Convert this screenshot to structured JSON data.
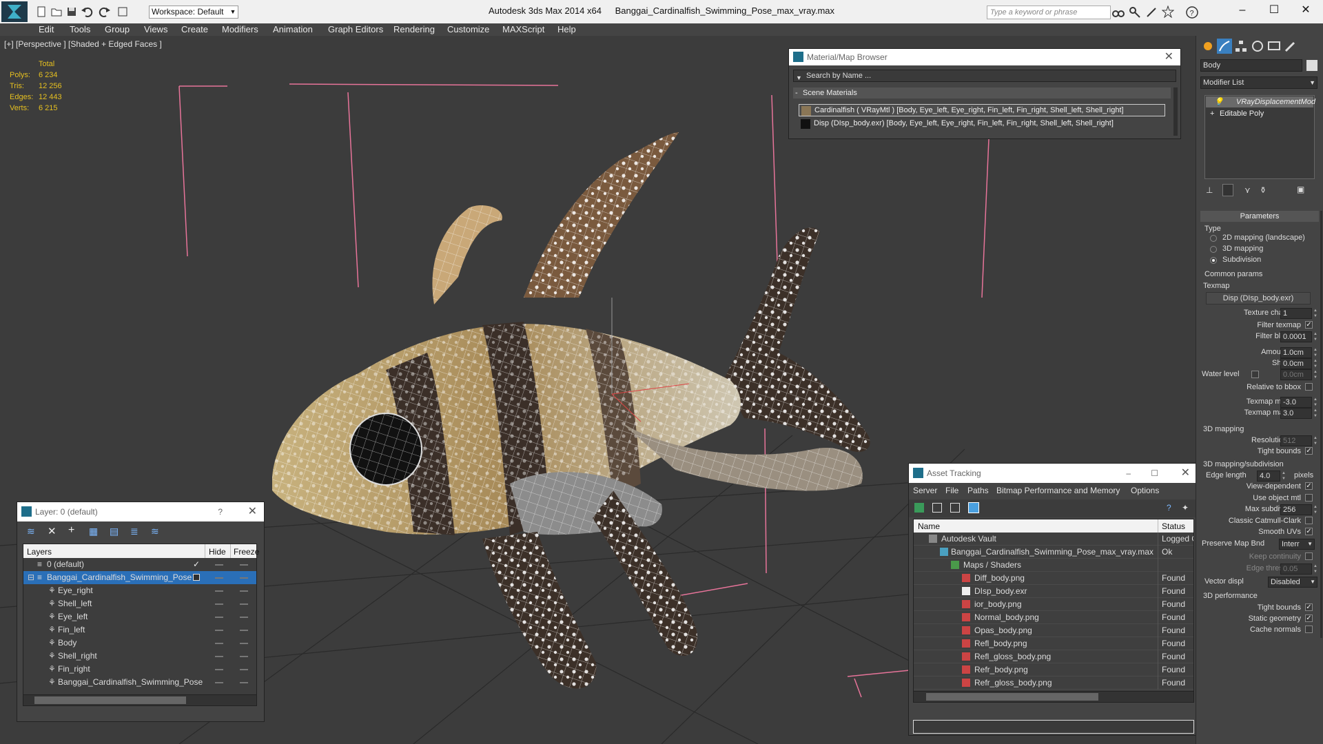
{
  "titlebar": {
    "workspace": "Workspace: Default",
    "app_title": "Autodesk 3ds Max  2014 x64",
    "file_title": "Banggai_Cardinalfish_Swimming_Pose_max_vray.max",
    "search_placeholder": "Type a keyword or phrase"
  },
  "menu": [
    "Edit",
    "Tools",
    "Group",
    "Views",
    "Create",
    "Modifiers",
    "Animation",
    "Graph Editors",
    "Rendering",
    "Customize",
    "MAXScript",
    "Help"
  ],
  "viewport": {
    "label": "[+] [Perspective ] [Shaded + Edged Faces ]",
    "stats": {
      "header": "Total",
      "rows": [
        {
          "label": "Polys:",
          "value": "6 234"
        },
        {
          "label": "Tris:",
          "value": "12 256"
        },
        {
          "label": "Edges:",
          "value": "12 443"
        },
        {
          "label": "Verts:",
          "value": "6 215"
        }
      ]
    }
  },
  "material_browser": {
    "title": "Material/Map Browser",
    "search_placeholder": "Search by Name ...",
    "section": "Scene Materials",
    "rows": [
      "Cardinalfish  ( VRayMtl )  [Body, Eye_left, Eye_right, Fin_left, Fin_right, Shell_left, Shell_right]",
      "Disp (DIsp_body.exr) [Body, Eye_left, Eye_right, Fin_left, Fin_right, Shell_left, Shell_right]"
    ]
  },
  "asset_tracking": {
    "title": "Asset Tracking",
    "menu": [
      "Server",
      "File",
      "Paths",
      "Bitmap Performance and Memory",
      "Options"
    ],
    "columns": [
      "Name",
      "Status"
    ],
    "rows": [
      {
        "name": "Autodesk Vault",
        "status": "Logged O"
      },
      {
        "name": "Banggai_Cardinalfish_Swimming_Pose_max_vray.max",
        "status": "Ok"
      },
      {
        "name": "Maps / Shaders",
        "status": ""
      },
      {
        "name": "Diff_body.png",
        "status": "Found"
      },
      {
        "name": "DIsp_body.exr",
        "status": "Found"
      },
      {
        "name": "ior_body.png",
        "status": "Found"
      },
      {
        "name": "Normal_body.png",
        "status": "Found"
      },
      {
        "name": "Opas_body.png",
        "status": "Found"
      },
      {
        "name": "Refl_body.png",
        "status": "Found"
      },
      {
        "name": "Refl_gloss_body.png",
        "status": "Found"
      },
      {
        "name": "Refr_body.png",
        "status": "Found"
      },
      {
        "name": "Refr_gloss_body.png",
        "status": "Found"
      }
    ]
  },
  "layer_panel": {
    "title": "Layer: 0 (default)",
    "help": "?",
    "columns": [
      "Layers",
      "Hide",
      "Freeze"
    ],
    "rows": [
      {
        "name": "0 (default)"
      },
      {
        "name": "Banggai_Cardinalfish_Swimming_Pose"
      },
      {
        "name": "Eye_right"
      },
      {
        "name": "Shell_left"
      },
      {
        "name": "Eye_left"
      },
      {
        "name": "Fin_left"
      },
      {
        "name": "Body"
      },
      {
        "name": "Shell_right"
      },
      {
        "name": "Fin_right"
      },
      {
        "name": "Banggai_Cardinalfish_Swimming_Pose"
      }
    ]
  },
  "command_panel": {
    "object_name": "Body",
    "modifier_list": "Modifier List",
    "stack": [
      "VRayDisplacementMod",
      "Editable Poly"
    ],
    "parameters": {
      "rollout": "Parameters",
      "type_label": "Type",
      "type_options": [
        "2D mapping (landscape)",
        "3D mapping",
        "Subdivision"
      ],
      "common_label": "Common params",
      "texmap_label": "Texmap",
      "texmap_value": "Disp (DIsp_body.exr)",
      "texture_chan_label": "Texture chan",
      "texture_chan_value": "1",
      "filter_texmap_label": "Filter texmap",
      "filter_blur_label": "Filter blur",
      "filter_blur_value": "0.0001",
      "amount_label": "Amount",
      "amount_value": "1.0cm",
      "shift_label": "Shift",
      "shift_value": "0.0cm",
      "water_label": "Water level",
      "water_value": "0.0cm",
      "relative_label": "Relative to bbox",
      "texmap_min_label": "Texmap min",
      "texmap_min_value": "-3.0",
      "texmap_max_label": "Texmap max",
      "texmap_max_value": "3.0"
    },
    "mapping_3d": {
      "label": "3D mapping",
      "resolution_label": "Resolution",
      "resolution_value": "512",
      "tight_bounds_label": "Tight bounds"
    },
    "subdivision": {
      "label": "3D mapping/subdivision",
      "edge_length_label": "Edge length",
      "edge_length_value": "4.0",
      "pixels_label": "pixels",
      "view_dependent_label": "View-dependent",
      "use_object_mtl_label": "Use object mtl",
      "max_subdivs_label": "Max subdivs",
      "max_subdivs_value": "256",
      "catmull_label": "Classic Catmull-Clark",
      "smooth_uvs_label": "Smooth UVs",
      "preserve_label": "Preserve Map Bnd",
      "preserve_value": "Interr",
      "keep_label": "Keep continuity",
      "edge_thresh_label": "Edge thresh",
      "edge_thresh_value": "0.05",
      "vector_label": "Vector displ",
      "vector_value": "Disabled"
    },
    "performance": {
      "label": "3D performance",
      "tight_bounds_label": "Tight bounds",
      "static_label": "Static geometry",
      "cache_label": "Cache normals"
    }
  }
}
